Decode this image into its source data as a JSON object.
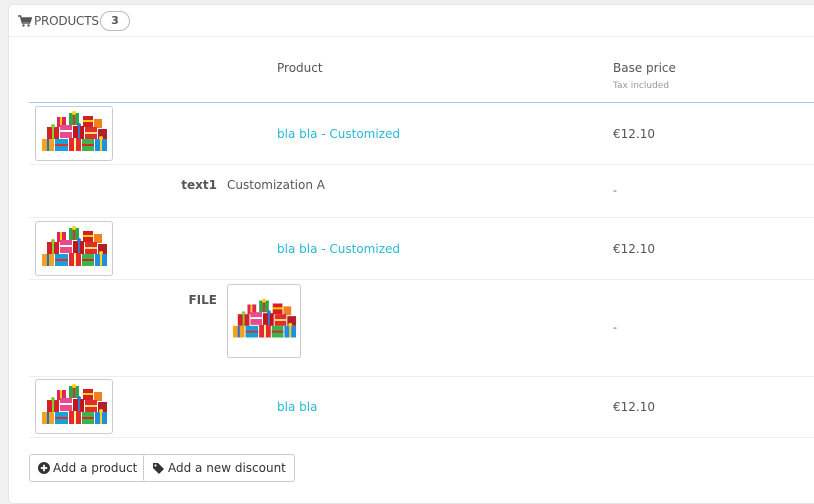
{
  "panel": {
    "title": "Products",
    "count": "3",
    "icon": "shopping-cart-icon"
  },
  "columns": {
    "product": "Product",
    "base_price": "Base price",
    "base_price_sub": "Tax included"
  },
  "rows": [
    {
      "name": "bla bla - Customized",
      "price": "€12.10"
    },
    {
      "name": "bla bla - Customized",
      "price": "€12.10"
    },
    {
      "name": "bla bla",
      "price": "€12.10"
    }
  ],
  "customizations": [
    {
      "label": "text1",
      "value": "Customization A",
      "price": "-"
    },
    {
      "label": "FILE",
      "price": "-"
    }
  ],
  "buttons": {
    "add_product": "Add a product",
    "add_discount": "Add a new discount"
  },
  "colors": {
    "link": "#25b9d7",
    "header_rule": "#a0d0eb"
  }
}
